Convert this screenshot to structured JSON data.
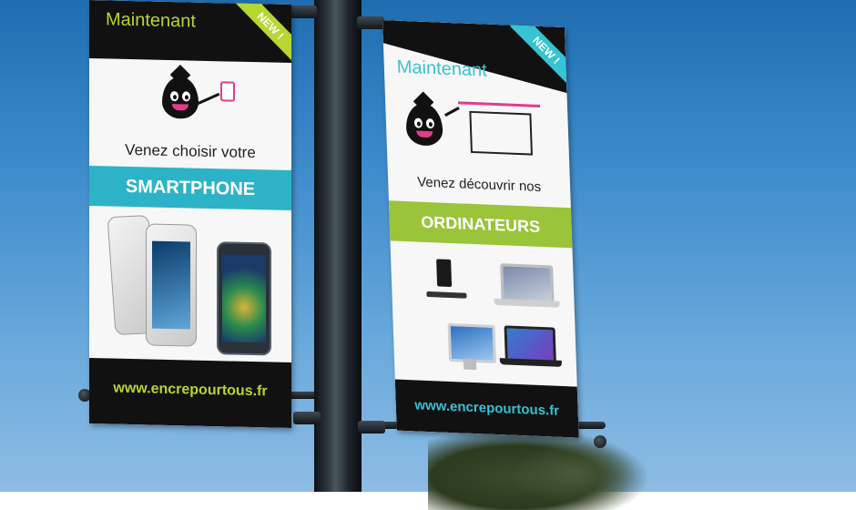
{
  "banner_left": {
    "headline": "Maintenant",
    "ribbon": "NEW !",
    "tagline": "Venez choisir votre",
    "category": "SMARTPHONE",
    "url": "www.encrepourtous.fr",
    "accent": "#b6d632",
    "band_color": "#2db3c7"
  },
  "banner_right": {
    "headline": "Maintenant",
    "ribbon": "NEW !",
    "tagline": "Venez découvrir nos",
    "category": "ORDINATEURS",
    "url": "www.encrepourtous.fr",
    "accent": "#36c3d2",
    "band_color": "#9ac43a"
  },
  "icons": [
    "ink-drop-mascot-icon",
    "smartphone-icon",
    "monitor-icon",
    "desktop-computer-icon",
    "laptop-icon",
    "all-in-one-computer-icon",
    "windows-laptop-icon"
  ]
}
